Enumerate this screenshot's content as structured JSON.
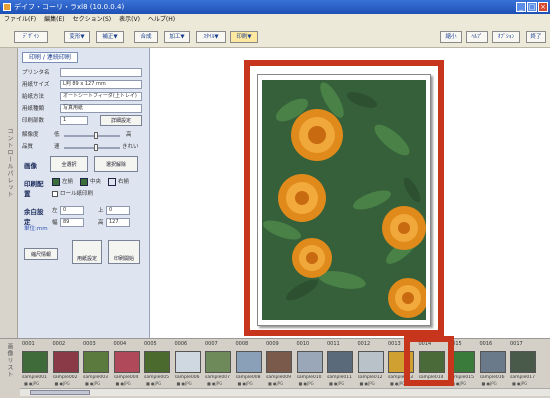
{
  "window": {
    "title": "デイフ・コーリ・ラxl8 (10.0.0.4)",
    "buttons": [
      "_",
      "□",
      "×"
    ]
  },
  "menu": [
    "ファイル(F)",
    "編集(E)",
    "セクション(S)",
    "表示(V)",
    "ヘルプ(H)"
  ],
  "toolbar": {
    "left": [
      "ﾃﾞｻﾞｲﾝ",
      "変形▼",
      "補正▼",
      "合成",
      "加工▼",
      "ｽﾀｲﾙ▼",
      "印刷▼"
    ],
    "right": [
      "縮小",
      "ﾍﾙﾌﾟ",
      "ｵﾌﾟｼｮﾝ",
      "終了"
    ]
  },
  "side_labels": {
    "left": "コントロールパレット",
    "bottom": "画像リスト"
  },
  "panel": {
    "tab": "印刷 / 連続印刷",
    "rows": [
      {
        "label": "プリンタ名",
        "value": ""
      },
      {
        "label": "用紙サイズ",
        "value": "L判 89 x 127 mm"
      },
      {
        "label": "給紙方法",
        "value": "オートシートフィーダ(上トレイ)"
      },
      {
        "label": "用紙種類",
        "value": "写真用紙"
      },
      {
        "label": "印刷部数",
        "value": "1"
      }
    ],
    "detail_button": "詳細設定",
    "slider1": {
      "label": "解像度",
      "low": "低",
      "high": "高"
    },
    "slider2": {
      "label": "品質",
      "low": "速",
      "high": "きれい"
    },
    "select_section": "画像",
    "select_all": "全選択",
    "deselect": "選択解除",
    "layout_section": "印刷配置",
    "align": [
      "左揃",
      "中央",
      "右揃"
    ],
    "fit_label": "ロール紙印刷",
    "margin_section": "余白設定",
    "margin_unit": "単位:mm",
    "margins": [
      {
        "label": "左",
        "value": "0"
      },
      {
        "label": "上",
        "value": "0"
      },
      {
        "label": "幅",
        "value": "89"
      },
      {
        "label": "高",
        "value": "127"
      }
    ],
    "extra_button": "縮尺情報",
    "preview_button": "用紙設定",
    "print_button": "印刷開始"
  },
  "thumbnails": [
    {
      "num": "0001",
      "name": "sample001",
      "color": "#3f6b3a"
    },
    {
      "num": "0002",
      "name": "sample002",
      "color": "#8a3a46"
    },
    {
      "num": "0003",
      "name": "sample003",
      "color": "#5a7a3e"
    },
    {
      "num": "0004",
      "name": "sample004",
      "color": "#b04a5a"
    },
    {
      "num": "0005",
      "name": "sample005",
      "color": "#4a6a2e"
    },
    {
      "num": "0006",
      "name": "sample006",
      "color": "#cfd8e0"
    },
    {
      "num": "0007",
      "name": "sample007",
      "color": "#6e8a5a"
    },
    {
      "num": "0008",
      "name": "sample008",
      "color": "#8aa0b8"
    },
    {
      "num": "0009",
      "name": "sample009",
      "color": "#7a5a4a"
    },
    {
      "num": "0010",
      "name": "sample010",
      "color": "#9aa7b8"
    },
    {
      "num": "0011",
      "name": "sample011",
      "color": "#5a6a7a"
    },
    {
      "num": "0012",
      "name": "sample012",
      "color": "#b8c2c8"
    },
    {
      "num": "0013",
      "name": "sample013",
      "color": "#d0a030"
    },
    {
      "num": "0014",
      "name": "sample014",
      "color": "#4a6a3a"
    },
    {
      "num": "0015",
      "name": "sample015",
      "color": "#3a7a3a"
    },
    {
      "num": "0016",
      "name": "sample016",
      "color": "#6a7a8a"
    },
    {
      "num": "0017",
      "name": "sample017",
      "color": "#4a5a4a"
    }
  ],
  "thumb_sub": "■ ●JPG",
  "colors": {
    "highlight": "#c6351c",
    "titlebar": "#1e50b4",
    "flower": "#e8a028"
  }
}
